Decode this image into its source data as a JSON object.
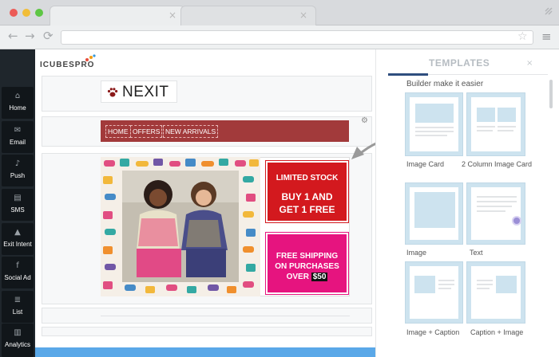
{
  "browser": {
    "controls": {
      "back_icon": "←",
      "forward_icon": "→",
      "reload_icon": "⟳",
      "star_icon": "☆",
      "menu_icon": "≡"
    }
  },
  "sidebar": {
    "items": [
      {
        "label": "Home",
        "icon": "home-icon",
        "glyph": "⌂"
      },
      {
        "label": "Email",
        "icon": "envelope-icon",
        "glyph": "✉"
      },
      {
        "label": "Push",
        "icon": "bell-icon",
        "glyph": "♪"
      },
      {
        "label": "SMS",
        "icon": "message-icon",
        "glyph": "▤"
      },
      {
        "label": "Exit Intent",
        "icon": "warning-icon",
        "glyph": "▲"
      },
      {
        "label": "Social Ad",
        "icon": "facebook-icon",
        "glyph": "f"
      },
      {
        "label": "List",
        "icon": "list-icon",
        "glyph": "≣"
      },
      {
        "label": "Analytics",
        "icon": "chart-icon",
        "glyph": "▥"
      }
    ]
  },
  "editor": {
    "brand": "ICUBESPRO",
    "logo_text": "NEXIT",
    "nav": [
      "HOME",
      "OFFERS",
      "NEW ARRIVALS"
    ],
    "promo1": {
      "line1": "LIMITED STOCK",
      "line2": "BUY 1 AND",
      "line3": "GET 1 FREE"
    },
    "promo2": {
      "line1": "FREE SHIPPING",
      "line2": "ON PURCHASES",
      "line3": "OVER",
      "amount": "$50"
    }
  },
  "panel": {
    "title": "TEMPLATES",
    "close_icon": "×",
    "subtitle": "Builder make it easier",
    "templates": [
      "Image Card",
      "2 Column Image Card",
      "Image",
      "Text",
      "Image + Caption",
      "Caption + Image"
    ]
  },
  "colors": {
    "accent": "#2e4e7e",
    "nav_bar": "#a23a3b",
    "promo_red": "#d3191e",
    "promo_pink": "#e6147f",
    "sidebar": "#1f262c"
  }
}
